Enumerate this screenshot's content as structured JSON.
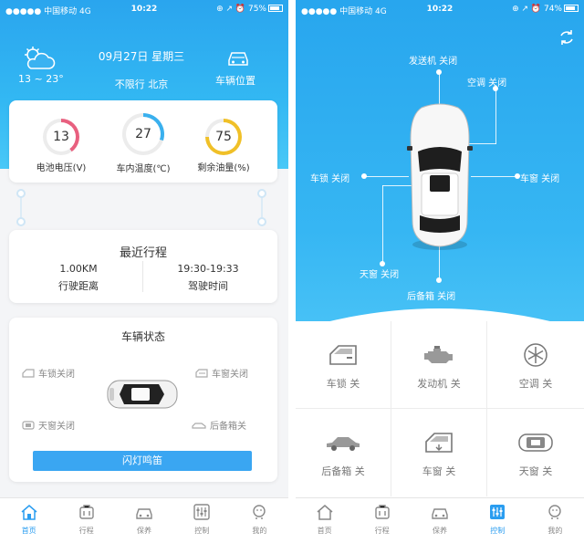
{
  "left": {
    "status": {
      "carrier": "●●●●● 中国移动",
      "network": "4G",
      "time": "10:22",
      "battery": "75%"
    },
    "header": {
      "date": "09月27日 星期三",
      "temp": "13 ~ 23°",
      "restriction": "不限行 北京",
      "car_location": "车辆位置"
    },
    "gauges": [
      {
        "value": "13",
        "label": "电池电压(V)",
        "color": "#e8607f",
        "fraction": 0.4
      },
      {
        "value": "27",
        "label": "车内温度(℃)",
        "color": "#3ab0ee",
        "fraction": 0.3
      },
      {
        "value": "75",
        "label": "剩余油量(%)",
        "color": "#f0c028",
        "fraction": 0.75
      }
    ],
    "trip": {
      "title": "最近行程",
      "distance": "1.00KM",
      "distance_label": "行驶距离",
      "time": "19:30-19:33",
      "time_label": "驾驶时间"
    },
    "status_card": {
      "title": "车辆状态",
      "lock": "车锁关闭",
      "window": "车窗关闭",
      "sunroof": "天窗关闭",
      "trunk": "后备箱关",
      "flash_button": "闪灯鸣笛"
    },
    "tabs": [
      {
        "label": "首页",
        "active": true
      },
      {
        "label": "行程",
        "active": false
      },
      {
        "label": "保养",
        "active": false
      },
      {
        "label": "控制",
        "active": false
      },
      {
        "label": "我的",
        "active": false
      }
    ]
  },
  "right": {
    "status": {
      "carrier": "●●●●● 中国移动",
      "network": "4G",
      "time": "10:22",
      "battery": "74%"
    },
    "labels": {
      "engine": "发送机  关闭",
      "ac": "空调  关闭",
      "lock": "车锁  关闭",
      "window": "车窗  关闭",
      "sunroof": "天窗  关闭",
      "trunk": "后备箱  关闭"
    },
    "controls": [
      {
        "label": "车锁 关",
        "icon": "car-door-icon"
      },
      {
        "label": "发动机 关",
        "icon": "engine-icon"
      },
      {
        "label": "空调 关",
        "icon": "snowflake-icon"
      },
      {
        "label": "后备箱 关",
        "icon": "car-side-icon"
      },
      {
        "label": "车窗 关",
        "icon": "window-icon"
      },
      {
        "label": "天窗 关",
        "icon": "sunroof-icon"
      }
    ],
    "tabs": [
      {
        "label": "首页",
        "active": false
      },
      {
        "label": "行程",
        "active": false
      },
      {
        "label": "保养",
        "active": false
      },
      {
        "label": "控制",
        "active": true
      },
      {
        "label": "我的",
        "active": false
      }
    ]
  }
}
